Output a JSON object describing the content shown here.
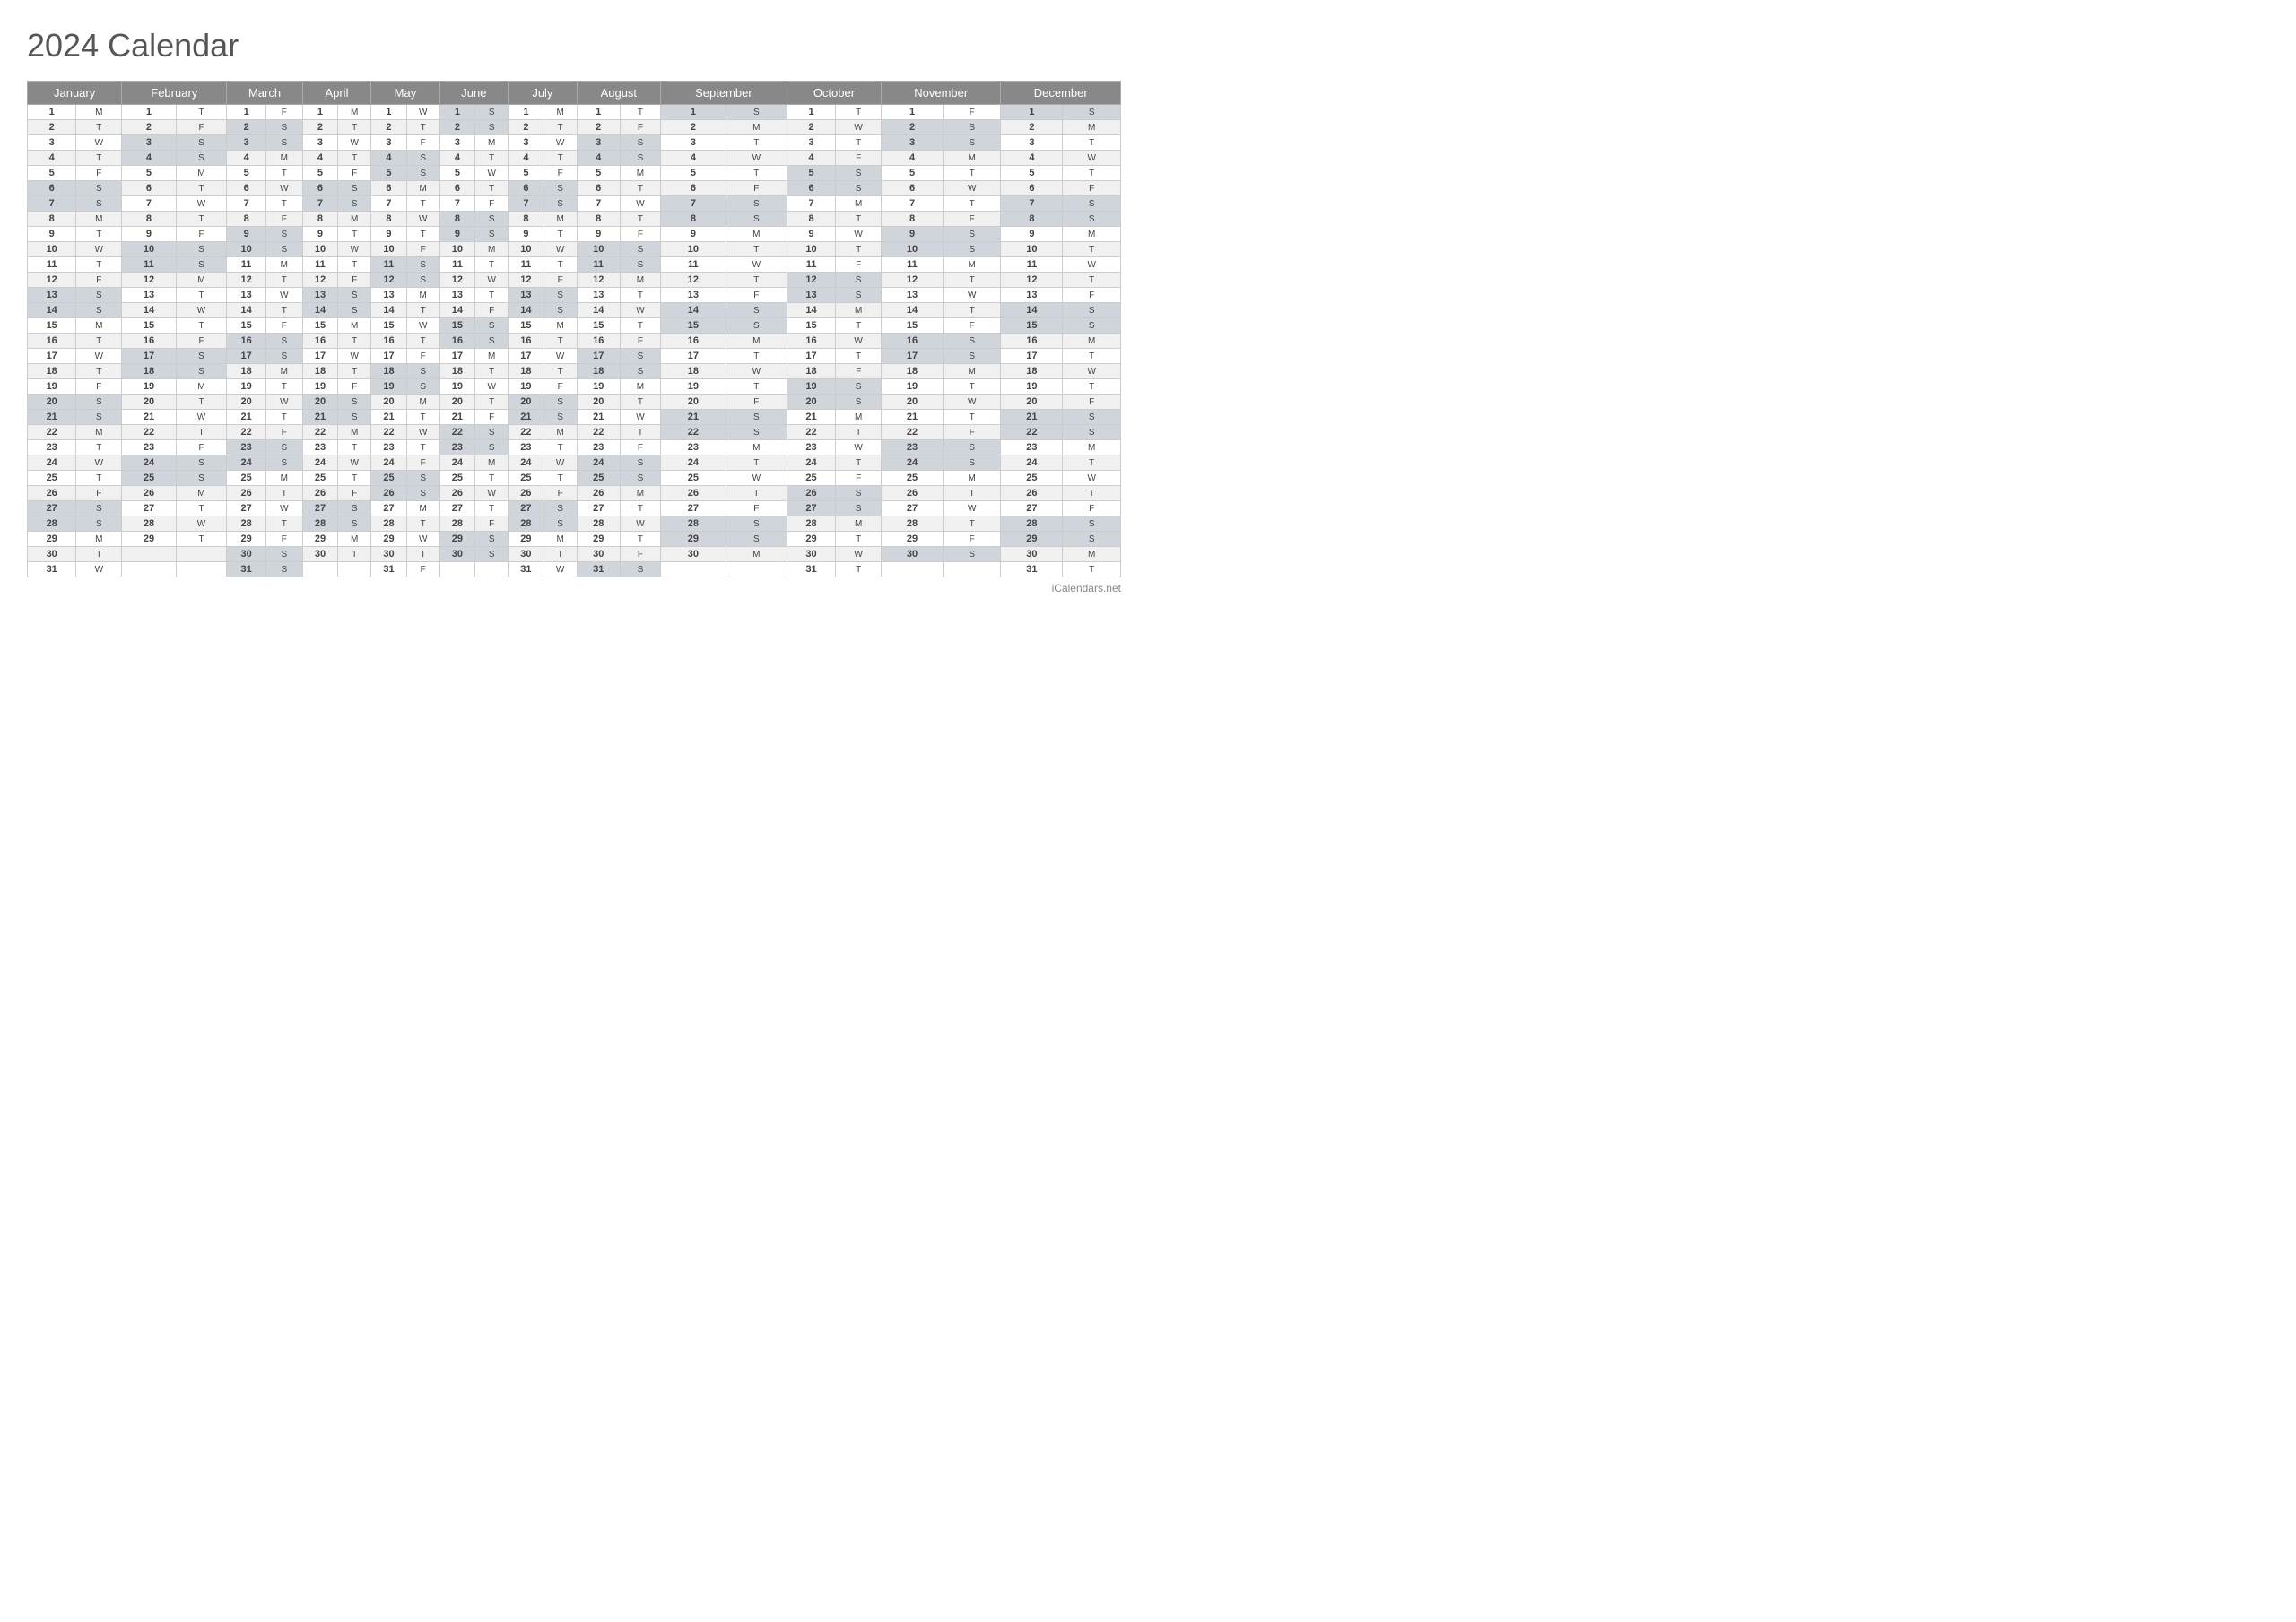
{
  "title": "2024 Calendar",
  "footer": "iCalendars.net",
  "months": [
    "January",
    "February",
    "March",
    "April",
    "May",
    "June",
    "July",
    "August",
    "September",
    "October",
    "November",
    "December"
  ],
  "days": {
    "January": [
      "M",
      "T",
      "W",
      "T",
      "F",
      "S",
      "S",
      "M",
      "T",
      "W",
      "T",
      "F",
      "S",
      "S",
      "M",
      "T",
      "W",
      "T",
      "F",
      "S",
      "S",
      "M",
      "T",
      "W",
      "T",
      "F",
      "S",
      "S",
      "M",
      "T",
      "W"
    ],
    "February": [
      "T",
      "F",
      "S",
      "S",
      "M",
      "T",
      "W",
      "T",
      "F",
      "S",
      "S",
      "M",
      "T",
      "W",
      "T",
      "F",
      "S",
      "S",
      "M",
      "T",
      "W",
      "T",
      "F",
      "S",
      "S",
      "M",
      "T",
      "W",
      "T"
    ],
    "March": [
      "F",
      "S",
      "S",
      "M",
      "T",
      "W",
      "T",
      "F",
      "S",
      "S",
      "M",
      "T",
      "W",
      "T",
      "F",
      "S",
      "S",
      "M",
      "T",
      "W",
      "T",
      "F",
      "S",
      "S",
      "M",
      "T",
      "W",
      "T",
      "F",
      "S",
      "S"
    ],
    "April": [
      "M",
      "T",
      "W",
      "T",
      "F",
      "S",
      "S",
      "M",
      "T",
      "W",
      "T",
      "F",
      "S",
      "S",
      "M",
      "T",
      "W",
      "T",
      "F",
      "S",
      "S",
      "M",
      "T",
      "W",
      "T",
      "F",
      "S",
      "S",
      "M",
      "T"
    ],
    "May": [
      "W",
      "T",
      "F",
      "S",
      "S",
      "M",
      "T",
      "W",
      "T",
      "F",
      "S",
      "S",
      "M",
      "T",
      "W",
      "T",
      "F",
      "S",
      "S",
      "M",
      "T",
      "W",
      "T",
      "F",
      "S",
      "S",
      "M",
      "T",
      "W",
      "T",
      "F"
    ],
    "June": [
      "S",
      "S",
      "M",
      "T",
      "W",
      "T",
      "F",
      "S",
      "S",
      "M",
      "T",
      "W",
      "T",
      "F",
      "S",
      "S",
      "M",
      "T",
      "W",
      "T",
      "F",
      "S",
      "S",
      "M",
      "T",
      "W",
      "T",
      "F",
      "S",
      "S"
    ],
    "July": [
      "M",
      "T",
      "W",
      "T",
      "F",
      "S",
      "S",
      "M",
      "T",
      "W",
      "T",
      "F",
      "S",
      "S",
      "M",
      "T",
      "W",
      "T",
      "F",
      "S",
      "S",
      "M",
      "T",
      "W",
      "T",
      "F",
      "S",
      "S",
      "M",
      "T",
      "W"
    ],
    "August": [
      "T",
      "F",
      "S",
      "S",
      "M",
      "T",
      "W",
      "T",
      "F",
      "S",
      "S",
      "M",
      "T",
      "W",
      "T",
      "F",
      "S",
      "S",
      "M",
      "T",
      "W",
      "T",
      "F",
      "S",
      "S",
      "M",
      "T",
      "W",
      "T",
      "F",
      "S"
    ],
    "September": [
      "S",
      "M",
      "T",
      "W",
      "T",
      "F",
      "S",
      "S",
      "M",
      "T",
      "W",
      "T",
      "F",
      "S",
      "S",
      "M",
      "T",
      "W",
      "T",
      "F",
      "S",
      "S",
      "M",
      "T",
      "W",
      "T",
      "F",
      "S",
      "S",
      "M"
    ],
    "October": [
      "T",
      "W",
      "T",
      "F",
      "S",
      "S",
      "M",
      "T",
      "W",
      "T",
      "F",
      "S",
      "S",
      "M",
      "T",
      "W",
      "T",
      "F",
      "S",
      "S",
      "M",
      "T",
      "W",
      "T",
      "F",
      "S",
      "S",
      "M",
      "T",
      "W",
      "T"
    ],
    "November": [
      "F",
      "S",
      "S",
      "M",
      "T",
      "W",
      "T",
      "F",
      "S",
      "S",
      "M",
      "T",
      "W",
      "T",
      "F",
      "S",
      "S",
      "M",
      "T",
      "W",
      "T",
      "F",
      "S",
      "S",
      "M",
      "T",
      "W",
      "T",
      "F",
      "S"
    ],
    "December": [
      "S",
      "M",
      "T",
      "W",
      "T",
      "F",
      "S",
      "S",
      "M",
      "T",
      "W",
      "T",
      "F",
      "S",
      "S",
      "M",
      "T",
      "W",
      "T",
      "F",
      "S",
      "S",
      "M",
      "T",
      "W",
      "T",
      "F",
      "S",
      "S",
      "M",
      "T"
    ]
  }
}
